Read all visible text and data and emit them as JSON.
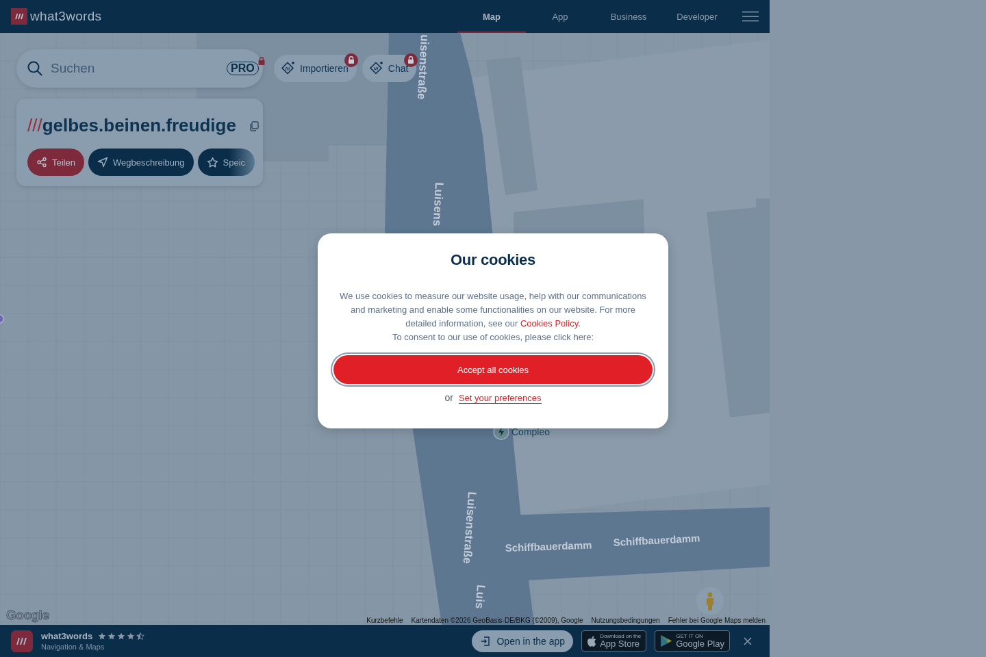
{
  "header": {
    "logo": "what3words",
    "nav": [
      {
        "label": "Map",
        "selected": true
      },
      {
        "label": "App",
        "selected": false
      },
      {
        "label": "Business",
        "selected": false
      },
      {
        "label": "Developer",
        "selected": false
      }
    ]
  },
  "search": {
    "placeholder": "Suchen",
    "badge": "PRO",
    "locked": true
  },
  "chips": [
    {
      "label": "Importieren",
      "locked": true
    },
    {
      "label": "Chat",
      "locked": true
    }
  ],
  "address": {
    "prefix": "///",
    "words": "gelbes.beinen.freudige",
    "actions": [
      {
        "label": "Teilen",
        "kind": "share"
      },
      {
        "label": "Wegbeschreibung",
        "kind": "directions"
      },
      {
        "label": "Speic",
        "kind": "save"
      }
    ]
  },
  "map": {
    "street_labels": [
      {
        "text": "uisenstraße",
        "kind": "vertical"
      },
      {
        "text": "Luisens",
        "kind": "vertical"
      },
      {
        "text": "Luisenstraße",
        "kind": "vertical"
      },
      {
        "text": "Luis",
        "kind": "vertical"
      },
      {
        "text": "Schiffbauerdamm",
        "kind": "horizontal"
      },
      {
        "text": "Schiffbauerdamm",
        "kind": "horizontal"
      }
    ],
    "poi": "Compleo",
    "logo": "Google",
    "attribution": [
      "Kurzbefehle",
      "Kartendaten ©2026 GeoBasis-DE/BKG (©2009), Google",
      "Nutzungsbedingungen",
      "Fehler bei Google Maps melden"
    ]
  },
  "cookie_dialog": {
    "title": "Our cookies",
    "body": "We use cookies to measure our website usage, help with our communications and marketing and enable some functionalities on our website. For more detailed information, see our",
    "policy_link": "Cookies Policy",
    "body_end": ".",
    "consent": "To consent to our use of cookies, please click here:",
    "accept_button": "Accept all cookies",
    "or": "or",
    "preferences_link": "Set your preferences"
  },
  "app_banner": {
    "name": "what3words",
    "stars": 4.5,
    "category": "Navigation & Maps",
    "open_button": "Open in the app",
    "app_store": {
      "small": "Download on the",
      "big": "App Store"
    },
    "google_play": {
      "small": "GET IT ON",
      "big": "Google Play"
    }
  }
}
